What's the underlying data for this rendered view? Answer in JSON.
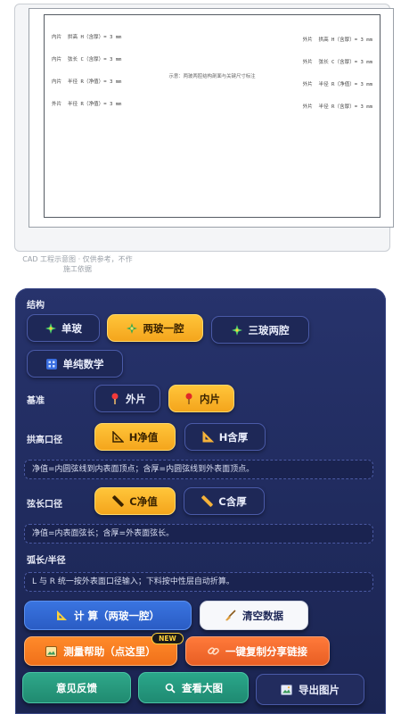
{
  "preview": {
    "dims_left": [
      "内片  拱高 H（含厚）= 3 mm",
      "内片  弦长 C（含厚）= 3 mm",
      "内片  半径 R（净值）= 3 mm",
      "外片  半径 R（净值）= 3 mm"
    ],
    "dims_right": [
      "外片  拱高 H（含厚）= 3 mm",
      "外片  弦长 C（含厚）= 3 mm",
      "外片  半径 R（净值）= 3 mm",
      "外片  半径 R（含厚）= 3 mm"
    ],
    "note": "示意：两玻两腔结构剖面与关键尺寸标注",
    "caption": "CAD 工程示意图 · 仅供参考，不作施工依据"
  },
  "structure": {
    "label": "结构",
    "options": [
      {
        "label": "单玻",
        "icon": "sparkle-icon",
        "active": false
      },
      {
        "label": "两玻一腔",
        "icon": "sparkle-icon",
        "active": true
      },
      {
        "label": "三玻两腔",
        "icon": "sparkle-icon",
        "active": false
      },
      {
        "label": "单纯数学",
        "icon": "grid-icon",
        "active": false
      }
    ]
  },
  "base": {
    "label": "基准",
    "options": [
      {
        "label": "外片",
        "icon": "pin-icon",
        "active": false
      },
      {
        "label": "内片",
        "icon": "pin-icon",
        "active": true
      }
    ]
  },
  "arch": {
    "label": "拱高口径",
    "options": [
      {
        "label": "H净值",
        "icon": "triangle-ruler-icon",
        "active": true
      },
      {
        "label": "H含厚",
        "icon": "triangle-ruler-icon",
        "active": false
      }
    ],
    "info": "净值=内圆弦线到内表面顶点；含厚=内圆弦线到外表面顶点。"
  },
  "chord": {
    "label": "弦长口径",
    "options": [
      {
        "label": "C净值",
        "icon": "ruler-icon",
        "active": true
      },
      {
        "label": "C含厚",
        "icon": "ruler-icon",
        "active": false
      }
    ],
    "info": "净值=内表面弦长；含厚=外表面弦长。"
  },
  "radius": {
    "label": "弧长/半径",
    "info": "L 与 R 统一按外表面口径输入；下料按中性层自动折算。"
  },
  "actions": {
    "calc": "计 算（两玻一腔）",
    "clear": "清空数据",
    "help": "测量帮助（点这里）",
    "help_badge": "NEW",
    "share": "一键复制分享链接",
    "feedback": "意见反馈",
    "view": "查看大图",
    "export": "导出图片"
  },
  "colors": {
    "panel": "#27336c",
    "active": "#ffc53a",
    "accent_blue": "#3a74e0",
    "accent_orange": "#f0701a",
    "accent_green": "#2fa88a"
  }
}
